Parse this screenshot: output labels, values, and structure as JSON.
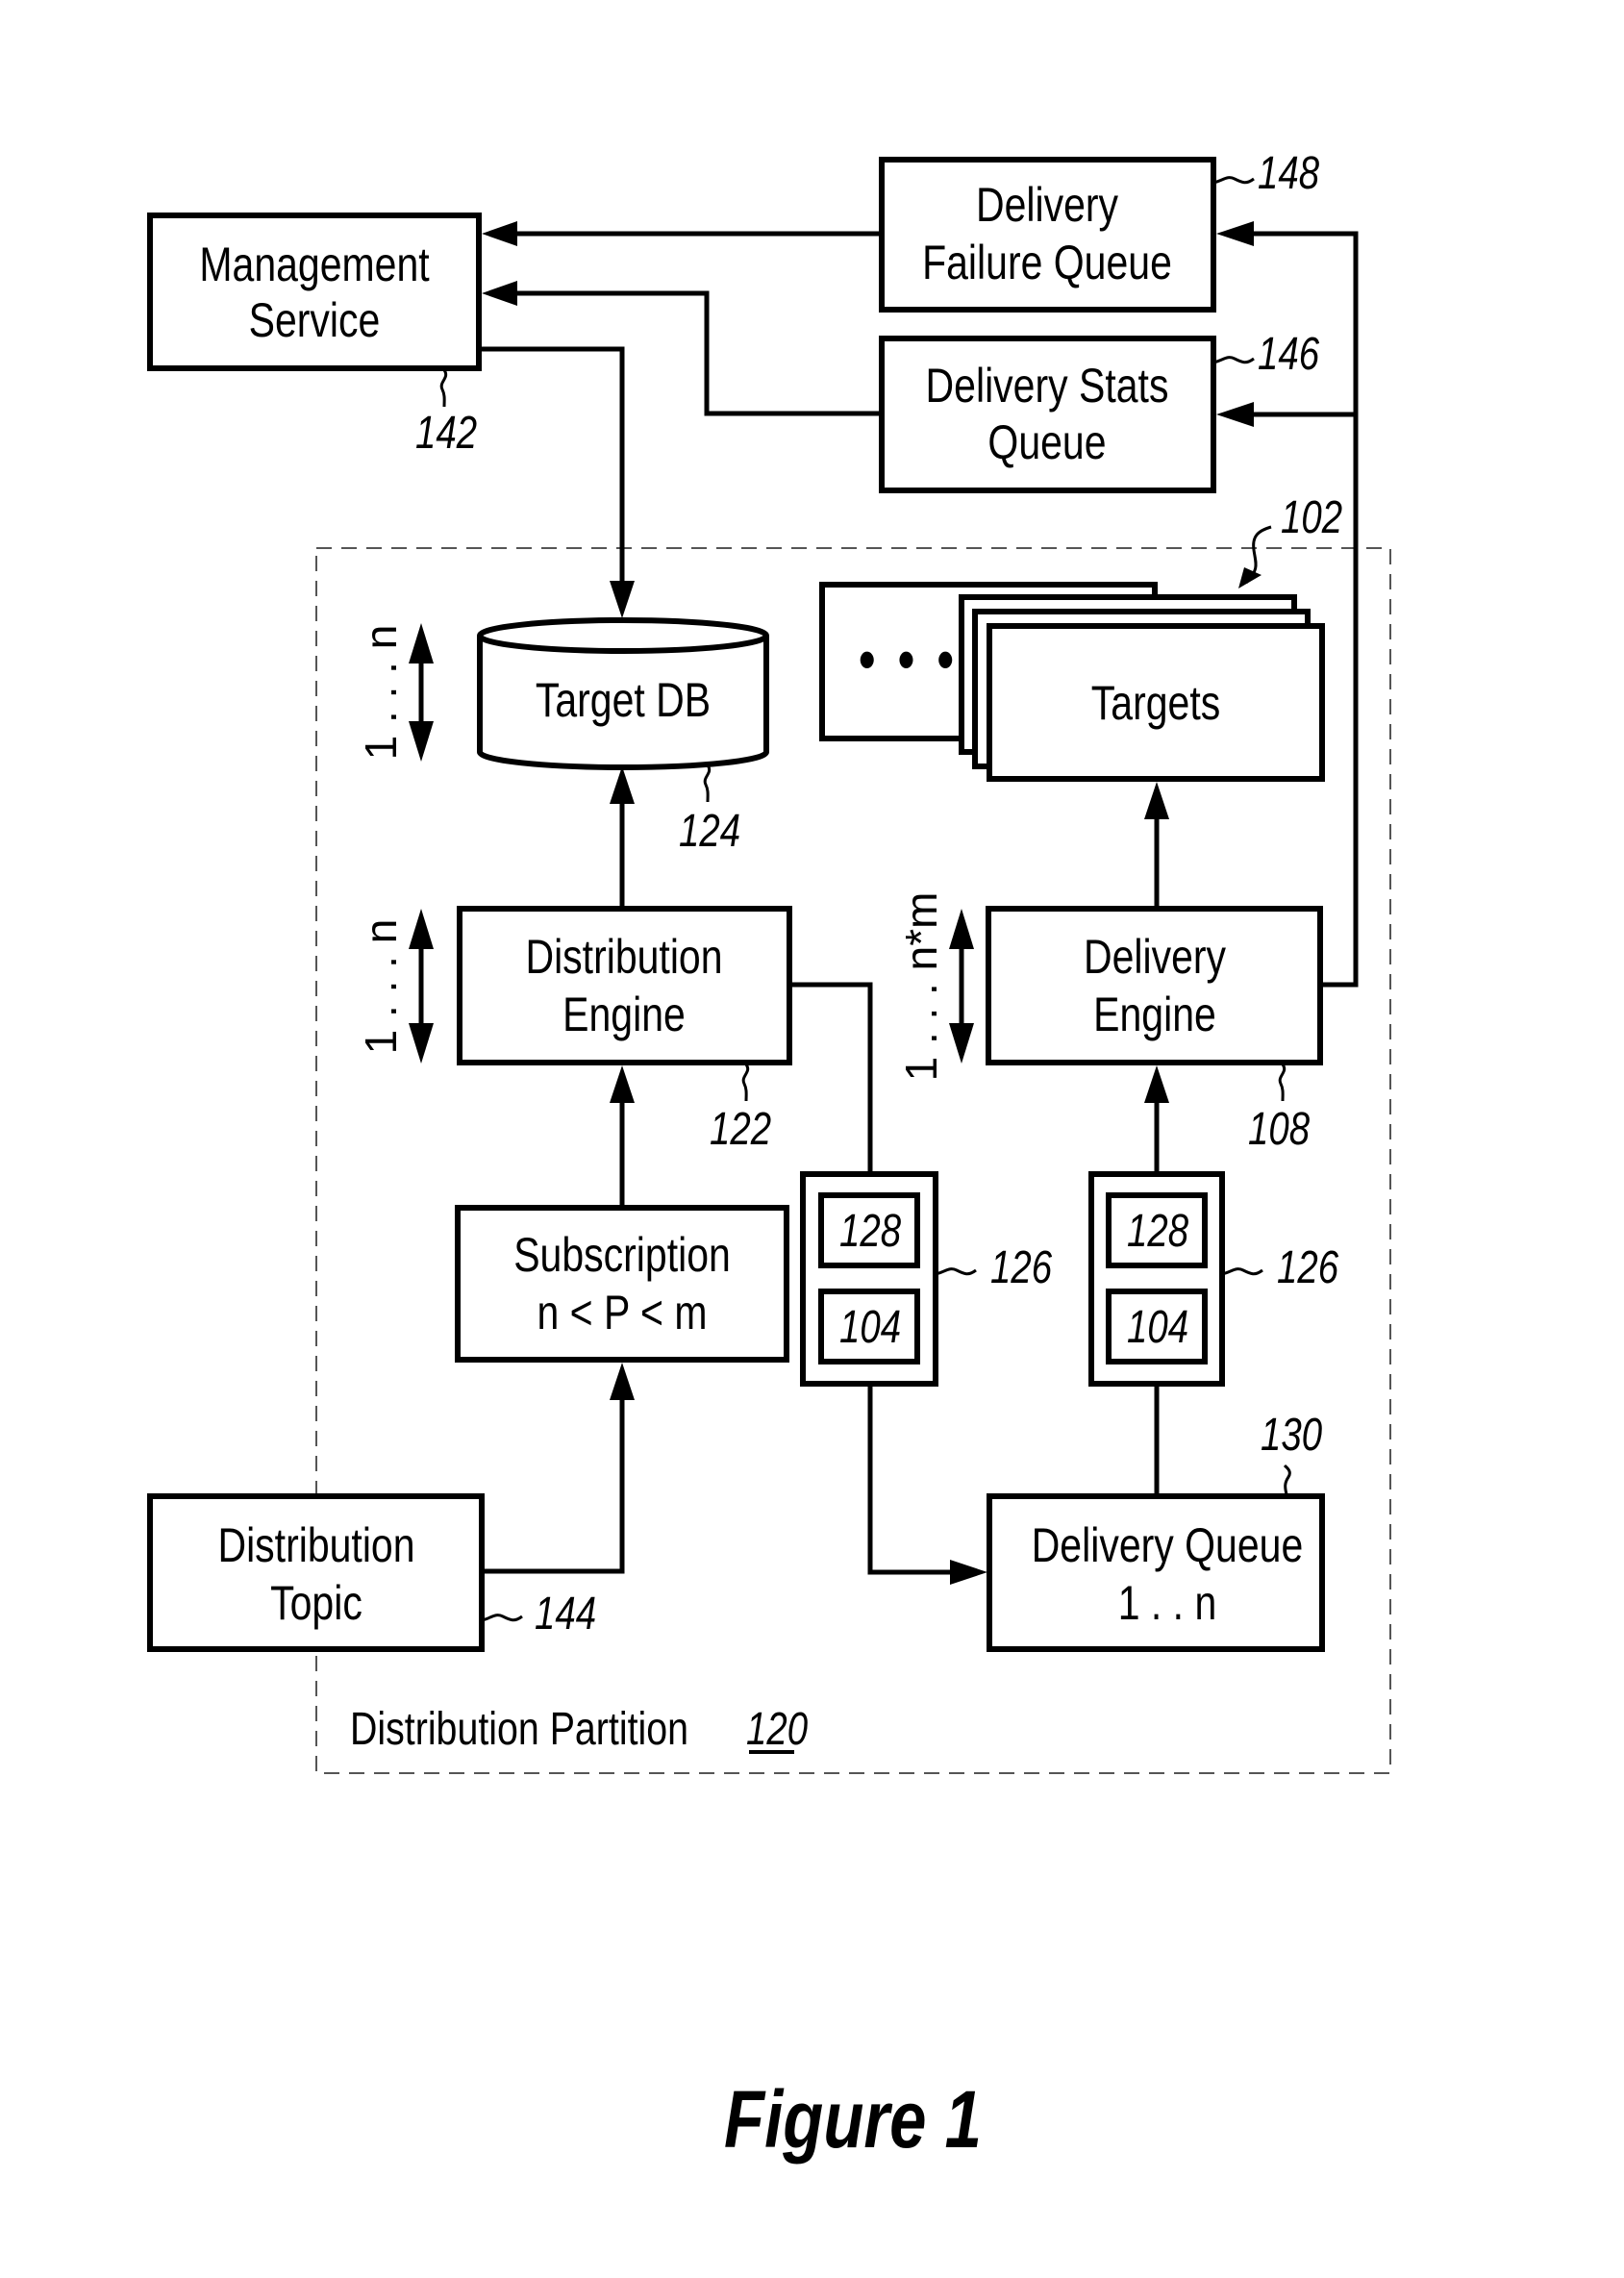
{
  "figure": {
    "caption": "Figure 1",
    "partition": {
      "label": "Distribution Partition",
      "ref": "120"
    }
  },
  "nodes": {
    "management_service": {
      "lines": [
        "Management",
        "Service"
      ],
      "ref": "142"
    },
    "delivery_failure_queue": {
      "lines": [
        "Delivery",
        "Failure Queue"
      ],
      "ref": "148"
    },
    "delivery_stats_queue": {
      "lines": [
        "Delivery Stats",
        "Queue"
      ],
      "ref": "146"
    },
    "target_db": {
      "lines": [
        "Target DB"
      ],
      "ref": "124",
      "multiplicity": "1 . . . n"
    },
    "targets": {
      "lines": [
        "Targets"
      ],
      "ref": "102",
      "ellipsis": "• • •"
    },
    "distribution_engine": {
      "lines": [
        "Distribution",
        "Engine"
      ],
      "ref": "122",
      "multiplicity": "1 . . . n"
    },
    "delivery_engine": {
      "lines": [
        "Delivery",
        "Engine"
      ],
      "ref": "108",
      "multiplicity": "1 . . . n*m"
    },
    "subscription": {
      "lines": [
        "Subscription",
        "n < P < m"
      ]
    },
    "message_left": {
      "ref": "126",
      "parts": [
        "128",
        "104"
      ]
    },
    "message_right": {
      "ref": "126",
      "parts": [
        "128",
        "104"
      ]
    },
    "distribution_topic": {
      "lines": [
        "Distribution",
        "Topic"
      ],
      "ref": "144"
    },
    "delivery_queue": {
      "lines": [
        "Delivery Queue",
        "1 . . n"
      ],
      "ref": "130"
    }
  },
  "edges": [
    {
      "from": "delivery_failure_queue",
      "to": "management_service"
    },
    {
      "from": "delivery_stats_queue",
      "to": "management_service"
    },
    {
      "from": "management_service",
      "to": "target_db"
    },
    {
      "from": "distribution_engine",
      "to": "target_db"
    },
    {
      "from": "subscription",
      "to": "distribution_engine"
    },
    {
      "from": "distribution_topic",
      "to": "subscription"
    },
    {
      "from": "distribution_engine",
      "to": "delivery_queue",
      "via": "message_left"
    },
    {
      "from": "delivery_queue",
      "to": "delivery_engine",
      "via": "message_right"
    },
    {
      "from": "delivery_engine",
      "to": "targets"
    },
    {
      "from": "delivery_engine",
      "to": "delivery_failure_queue"
    },
    {
      "from": "delivery_engine",
      "to": "delivery_stats_queue"
    }
  ]
}
